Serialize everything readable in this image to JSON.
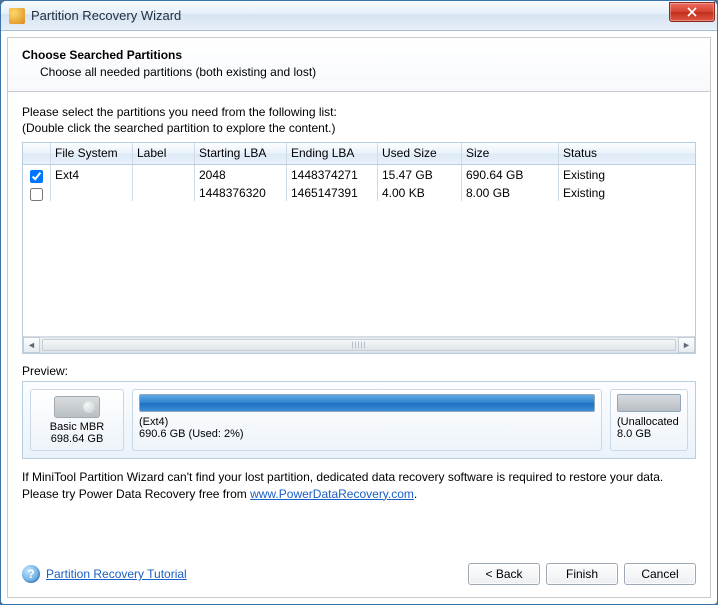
{
  "window": {
    "title": "Partition Recovery Wizard"
  },
  "header": {
    "title": "Choose Searched Partitions",
    "subtitle": "Choose all needed partitions (both existing and lost)"
  },
  "instructions": {
    "line1": "Please select the partitions you need from the following list:",
    "line2": "(Double click the searched partition to explore the content.)"
  },
  "table": {
    "columns": {
      "chk": "",
      "fs": "File System",
      "label": "Label",
      "slba": "Starting LBA",
      "elba": "Ending LBA",
      "used": "Used Size",
      "size": "Size",
      "status": "Status"
    },
    "rows": [
      {
        "checked": true,
        "fs": "Ext4",
        "label": "",
        "slba": "2048",
        "elba": "1448374271",
        "used": "15.47 GB",
        "size": "690.64 GB",
        "status": "Existing"
      },
      {
        "checked": false,
        "fs": "",
        "label": "",
        "slba": "1448376320",
        "elba": "1465147391",
        "used": "4.00 KB",
        "size": "8.00 GB",
        "status": "Existing"
      }
    ]
  },
  "preview": {
    "label": "Preview:",
    "disk": {
      "name": "Basic MBR",
      "size": "698.64 GB"
    },
    "partitions": {
      "main": {
        "label": "(Ext4)",
        "detail": "690.6 GB (Used: 2%)",
        "fill_percent": 100
      },
      "unalloc": {
        "label": "(Unallocated",
        "detail": "8.0 GB"
      }
    }
  },
  "note": {
    "text_before": "If MiniTool Partition Wizard can't find your lost partition, dedicated data recovery software is required to restore your data. Please try Power Data Recovery free from ",
    "link_text": "www.PowerDataRecovery.com",
    "text_after": "."
  },
  "tutorial": {
    "link_text": "Partition Recovery Tutorial"
  },
  "buttons": {
    "back": "< Back",
    "finish": "Finish",
    "cancel": "Cancel"
  }
}
